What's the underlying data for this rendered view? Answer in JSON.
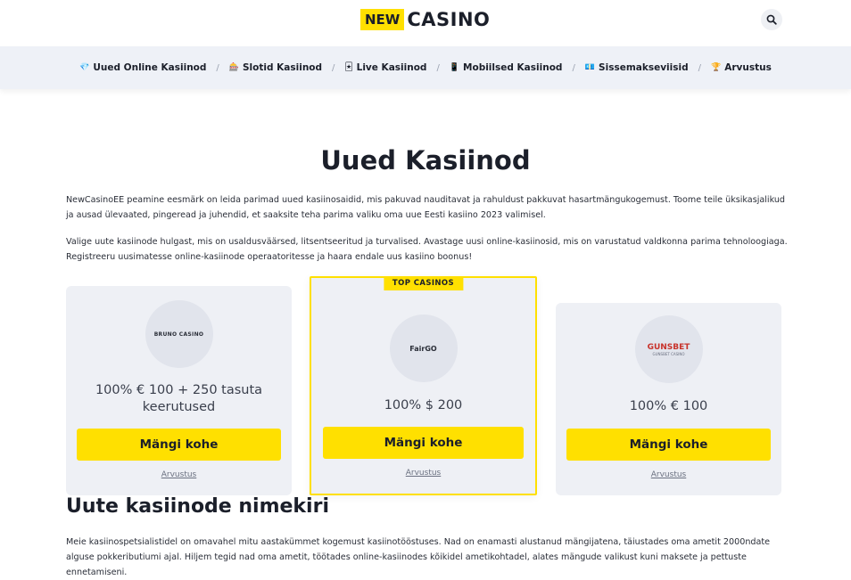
{
  "header": {
    "logo_new": "NEW",
    "logo_casino": "CASINO",
    "search_icon": "search-icon"
  },
  "nav": {
    "items": [
      {
        "icon": "💎",
        "label": "Uued Online Kasiinod"
      },
      {
        "icon": "🎰",
        "label": "Slotid Kasiinod"
      },
      {
        "icon": "🃏",
        "label": "Live Kasiinod"
      },
      {
        "icon": "📱",
        "label": "Mobiilsed Kasiinod"
      },
      {
        "icon": "💶",
        "label": "Sissemakseviisid"
      },
      {
        "icon": "🏆",
        "label": "Arvustus"
      }
    ],
    "separator": "/"
  },
  "main": {
    "title": "Uued Kasiinod",
    "intro_1": "NewCasinoEE peamine eesmärk on leida parimad uued kasiinosaidid, mis pakuvad nauditavat ja rahuldust pakkuvat hasartmängukogemust. Toome teile üksikasjalikud ja ausad ülevaated, pingeread ja juhendid, et saaksite teha parima valiku oma uue Eesti kasiino 2023 valimisel.",
    "intro_2": "Valige uute kasiinode hulgast, mis on usaldusväärsed, litsentseeritud ja turvalised. Avastage uusi online-kasiinosid, mis on varustatud valdkonna parima tehnoloogiaga. Registreeru uusimatesse online-kasiinode operaatoritesse ja haara endale uus kasiino boonus!",
    "subtitle": "Uute kasiinode nimekiri",
    "bottom_text": "Meie kasiinospetsialistidel on omavahel mitu aastakümmet kogemust kasiinotööstuses. Nad on enamasti alustanud mängijatena, täiustades oma ametit 2000ndate alguse pokkeributiumi ajal. Hiljem tegid nad oma ametit, töötades online-kasiinodes kõikidel ametikohtadel, alates mängude valikust kuni maksete ja pettuste ennetamiseni."
  },
  "cards": [
    {
      "logo_text": "BRUNO CASINO",
      "bonus": "100% € 100 + 250 tasuta keerutused",
      "play_label": "Mängi kohe",
      "review_label": "Arvustus"
    },
    {
      "badge": "TOP CASINOS",
      "logo_text": "FairGO",
      "bonus": "100% $ 200",
      "play_label": "Mängi kohe",
      "review_label": "Arvustus"
    },
    {
      "logo_text": "GUNSBET",
      "logo_sub": "GUNSBET CASINO",
      "bonus": "100% € 100",
      "play_label": "Mängi kohe",
      "review_label": "Arvustus"
    }
  ],
  "colors": {
    "accent": "#ffe000",
    "text": "#1b1f2a",
    "nav_bg": "#eef1f7",
    "card_bg": "#eef0f5"
  }
}
